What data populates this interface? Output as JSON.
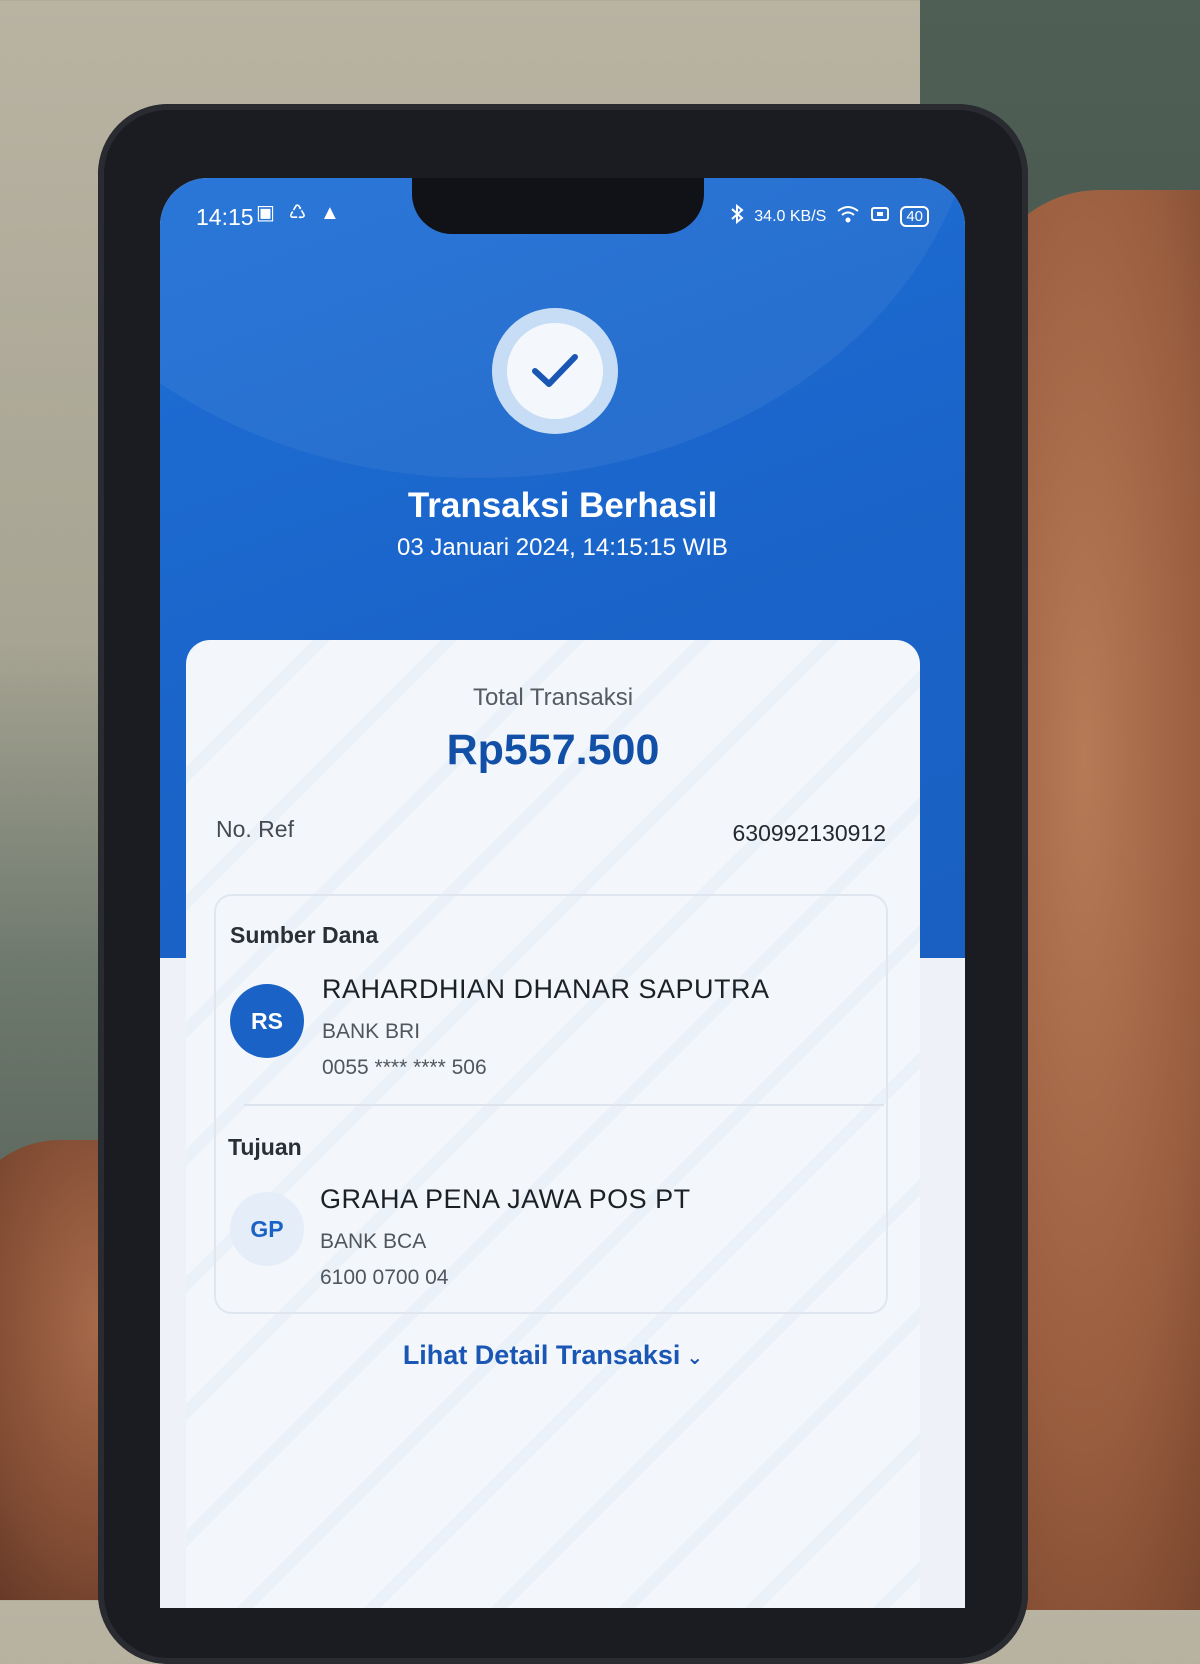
{
  "status_bar": {
    "time": "14:15",
    "left_icons": [
      "▣",
      "♺",
      "▲"
    ],
    "network_speed": "34.0 KB/S",
    "battery": "40"
  },
  "header": {
    "title": "Transaksi Berhasil",
    "datetime": "03 Januari 2024, 14:15:15 WIB"
  },
  "card": {
    "total_label": "Total Transaksi",
    "total_amount": "Rp557.500",
    "ref_label": "No. Ref",
    "ref_value": "630992130912",
    "source": {
      "section_label": "Sumber Dana",
      "initials": "RS",
      "name": "RAHARDHIAN DHANAR SAPUTRA",
      "bank": "BANK BRI",
      "account": "0055 **** **** 506"
    },
    "destination": {
      "section_label": "Tujuan",
      "initials": "GP",
      "name": "GRAHA PENA JAWA POS PT",
      "bank": "BANK BCA",
      "account": "6100 0700 04"
    },
    "detail_link": "Lihat Detail Transaksi"
  },
  "colors": {
    "primary_blue": "#1a63c8",
    "amount_blue": "#124fa6",
    "card_bg": "#f3f7fb"
  }
}
